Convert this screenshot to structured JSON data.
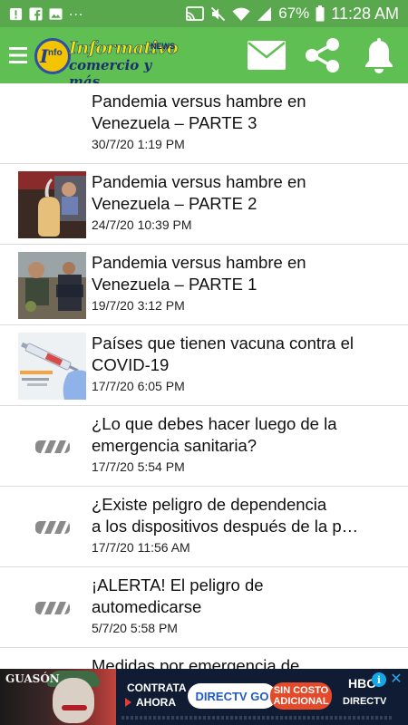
{
  "status_bar": {
    "battery": "67%",
    "time": "11:28 AM",
    "dots": "...",
    "left_icons": [
      "alert-icon",
      "facebook-icon",
      "image-icon"
    ],
    "right_icons": [
      "cast-icon",
      "mute-icon",
      "wifi-icon",
      "signal-icon",
      "battery-icon"
    ]
  },
  "app_bar": {
    "logo_title": "Informativo",
    "logo_badge": "I",
    "logo_badge_sub": "nfo",
    "logo_news": "NEWS",
    "logo_subtitle": "comercio y más",
    "actions": [
      "mail-icon",
      "share-icon",
      "bell-icon"
    ]
  },
  "articles": [
    {
      "title_lines": [
        "Pandemia versus hambre en",
        "Venezuela – PARTE 3"
      ],
      "date": "30/7/20 1:19 PM",
      "thumb": "none"
    },
    {
      "title_lines": [
        "Pandemia versus hambre en",
        "Venezuela – PARTE 2"
      ],
      "date": "24/7/20 10:39 PM",
      "thumb": "photo-bottle"
    },
    {
      "title_lines": [
        "Pandemia versus hambre en",
        "Venezuela – PARTE 1"
      ],
      "date": "19/7/20 3:12 PM",
      "thumb": "photo-people"
    },
    {
      "title_lines": [
        "Países que tienen vacuna contra el",
        "COVID-19"
      ],
      "date": "17/7/20 6:05 PM",
      "thumb": "photo-vaccine"
    },
    {
      "title_lines": [
        "¿Lo que debes hacer luego de la",
        "emergencia sanitaria?"
      ],
      "date": "17/7/20 5:54 PM",
      "thumb": "placeholder"
    },
    {
      "title_lines": [
        "¿Existe peligro de dependencia",
        "a los dispositivos después de la p…"
      ],
      "date": "17/7/20 11:56 AM",
      "thumb": "placeholder"
    },
    {
      "title_lines": [
        "¡ALERTA! El peligro de",
        "automedicarse"
      ],
      "date": "5/7/20 5:58 PM",
      "thumb": "placeholder"
    },
    {
      "title_lines": [
        "Medidas por emergencia de",
        ""
      ],
      "date": "",
      "thumb": "placeholder"
    }
  ],
  "ad": {
    "joker_label": "GUASÓN",
    "text1": "CONTRATA",
    "text2": "AHORA",
    "brand": "DIRECTV GO",
    "offer_line1": "SIN COSTO",
    "offer_line2": "ADICIONAL",
    "hbo": "HBO",
    "directv": "DIRECTV",
    "info": "i",
    "close": "✕"
  },
  "colors": {
    "status_bar": "#5aa84e",
    "app_bar": "#5fbf52",
    "divider": "#dcdcdc",
    "ad_bg": "#0f1c33"
  }
}
